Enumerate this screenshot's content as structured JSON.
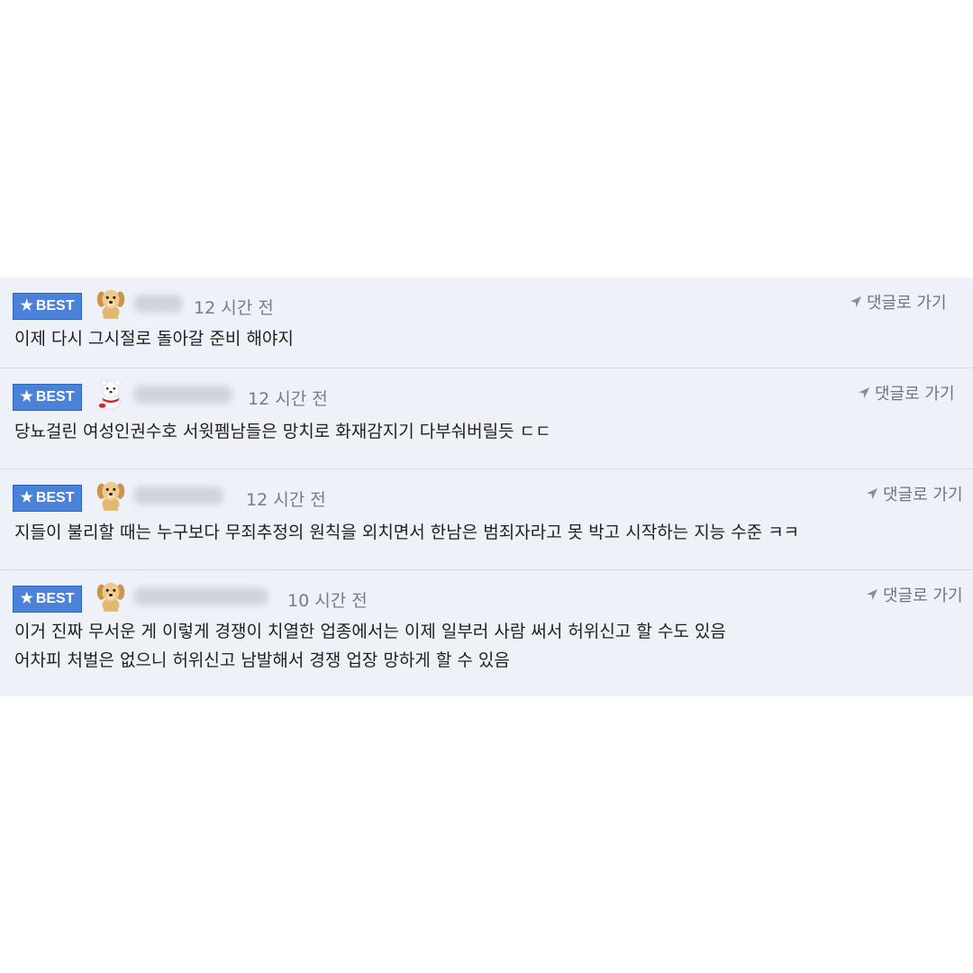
{
  "comments": [
    {
      "badge": "BEST",
      "time": "12 시간 전",
      "goto_label": "댓글로 가기",
      "avatar": "puppy-avatar",
      "lines": [
        "이제 다시 그시절로 돌아갈 준비 해야지"
      ]
    },
    {
      "badge": "BEST",
      "time": "12 시간 전",
      "goto_label": "댓글로 가기",
      "avatar": "bear-avatar",
      "lines": [
        "당뇨걸린 여성인권수호 서윗펨남들은 망치로 화재감지기 다부숴버릴듯 ㄷㄷ"
      ]
    },
    {
      "badge": "BEST",
      "time": "12 시간 전",
      "goto_label": "댓글로 가기",
      "avatar": "puppy-avatar",
      "lines": [
        "지들이 불리할 때는 누구보다 무죄추정의 원칙을 외치면서 한남은 범죄자라고 못 박고 시작하는 지능 수준 ㅋㅋ"
      ]
    },
    {
      "badge": "BEST",
      "time": "10 시간 전",
      "goto_label": "댓글로 가기",
      "avatar": "puppy-avatar",
      "lines": [
        "이거 진짜 무서운 게 이렇게 경쟁이 치열한 업종에서는 이제 일부러 사람 써서 허위신고 할 수도 있음",
        "어차피 처벌은 없으니 허위신고 남발해서 경쟁 업장 망하게 할 수 있음"
      ]
    }
  ],
  "colors": {
    "badge_bg": "#4a82d9",
    "panel_bg": "#eef2f8",
    "divider": "#d5dbe5"
  }
}
